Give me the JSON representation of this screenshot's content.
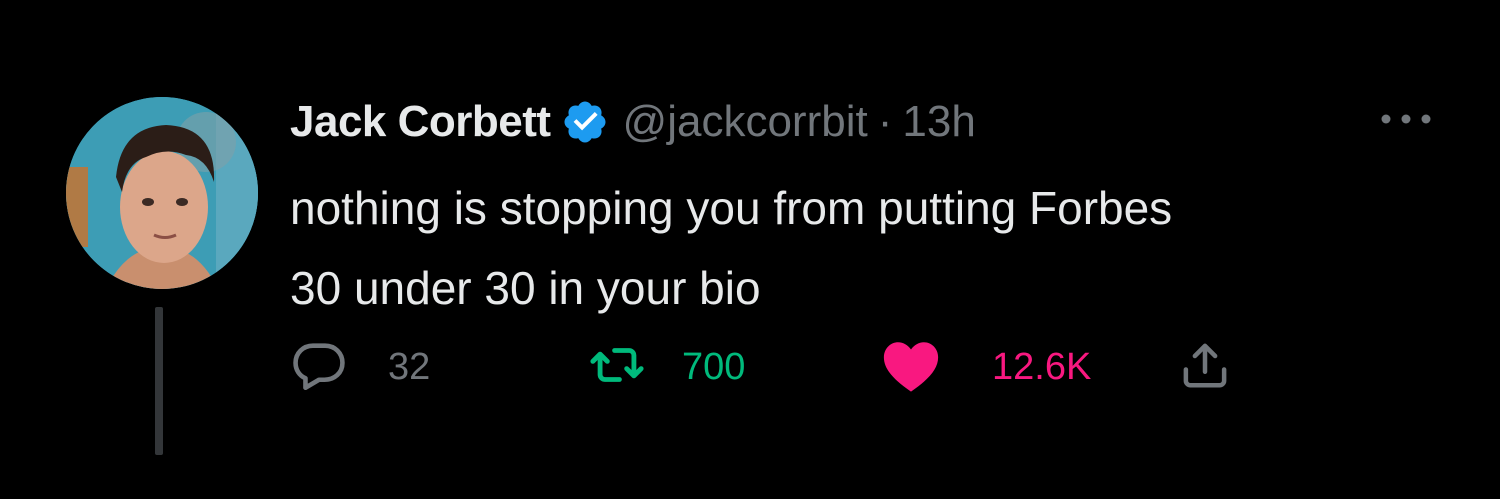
{
  "tweet": {
    "author": {
      "name": "Jack Corbett",
      "handle": "@jackcorrbit",
      "verified": true
    },
    "separator": "·",
    "time": "13h",
    "text_lines": [
      "nothing is stopping you from putting Forbes",
      "30 under 30 in your bio"
    ],
    "actions": {
      "reply": {
        "icon": "reply-icon",
        "count": "32"
      },
      "retweet": {
        "icon": "retweet-icon",
        "count": "700",
        "active": true
      },
      "like": {
        "icon": "heart-icon",
        "count": "12.6K",
        "active": true
      },
      "share": {
        "icon": "share-icon"
      }
    }
  },
  "colors": {
    "background": "#000000",
    "primary_text": "#e7e9ea",
    "secondary_text": "#71767b",
    "verified_blue": "#1d9bf0",
    "retweet_green": "#00ba7c",
    "like_pink": "#f91880",
    "thread_line": "#333639"
  }
}
